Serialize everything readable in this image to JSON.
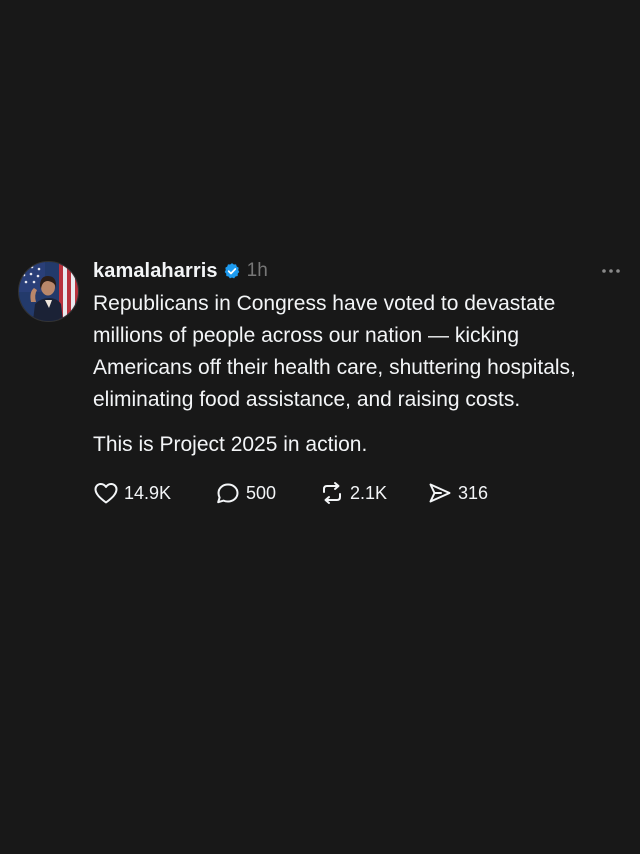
{
  "post": {
    "username": "kamalaharris",
    "timestamp": "1h",
    "paragraphs": [
      "Republicans in Congress have voted to devastate millions of people across our nation — kicking Americans off their health care, shuttering hospitals, eliminating food assistance, and raising costs.",
      "This is Project 2025 in action."
    ],
    "actions": {
      "likes": "14.9K",
      "replies": "500",
      "reposts": "2.1K",
      "shares": "316"
    }
  },
  "icons": {
    "verified": "verified-badge-icon",
    "more": "more-options-icon",
    "like": "heart-icon",
    "reply": "comment-bubble-icon",
    "repost": "repost-icon",
    "share": "send-icon"
  },
  "colors": {
    "background": "#181818",
    "text": "#f3f5f7",
    "muted": "#777777",
    "verified": "#1d9bf0"
  }
}
